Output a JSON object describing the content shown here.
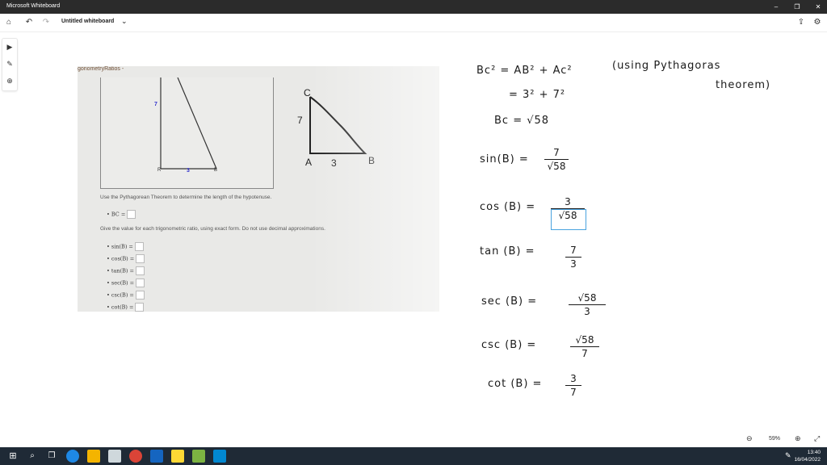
{
  "window": {
    "title": "Microsoft Whiteboard",
    "minimize": "–",
    "restore": "❐",
    "close": "✕"
  },
  "toolbar": {
    "doc_title": "Untitled whiteboard",
    "chevron": "⌄"
  },
  "rail": {
    "select": "▶",
    "pen": "✎",
    "add": "⊕"
  },
  "screenshot": {
    "header": "gonometryRatios -",
    "side_7": "7",
    "vertex_r": "R",
    "base_3": "3",
    "vertex_b": "B",
    "instruction1": "Use the Pythagorean Theorem to determine the length of the hypotenuse.",
    "bc_label": "BC =",
    "instruction2": "Give the value for each trigonometric ratio, using exact form. Do not use decimal approximations.",
    "ratios": [
      "sin(B) =",
      "cos(B) =",
      "tan(B) =",
      "sec(B) =",
      "csc(B) =",
      "cot(B) ="
    ]
  },
  "sketch": {
    "c": "C",
    "seven": "7",
    "a": "A",
    "three": "3",
    "b": "B"
  },
  "notes": {
    "line1": "Bc² = AB² + Ac²",
    "paren1": "(using Pythagoras",
    "paren2": "theorem)",
    "line2": "= 3² + 7²",
    "line3": "Bc = √58",
    "sin_label": "sin(B) =",
    "sin_num": "7",
    "sin_den": "√58",
    "cos_label": "cos (B) =",
    "cos_num": "3",
    "cos_den": "√58",
    "tan_label": "tan (B) =",
    "tan_num": "7",
    "tan_den": "3",
    "sec_label": "sec (B) =",
    "sec_num": "√58",
    "sec_den": "3",
    "csc_label": "csc (B) =",
    "csc_num": "√58",
    "csc_den": "7",
    "cot_label": "cot (B) =",
    "cot_num": "3",
    "cot_den": "7"
  },
  "zoom": {
    "out": "⊖",
    "level": "59%",
    "in": "⊕",
    "fit": "⤢"
  },
  "clock": {
    "time": "13:40",
    "date": "16/04/2022"
  },
  "colors": {
    "titlebar": "#2b2b2b",
    "taskbar": "#1f2a36",
    "selection": "#4aa3df",
    "vertex_label": "#3333cc"
  }
}
